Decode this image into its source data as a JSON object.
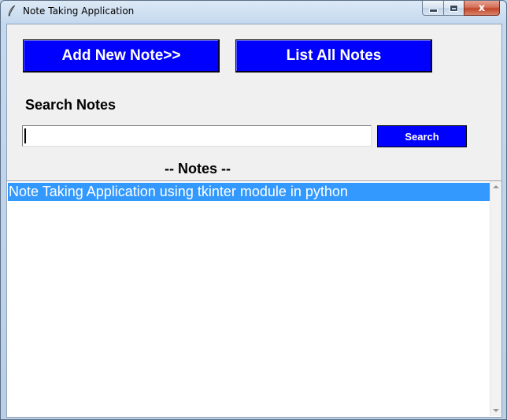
{
  "window": {
    "title": "Note Taking Application",
    "icon": "feather-icon",
    "close_glyph": "x"
  },
  "toolbar": {
    "add_label": "Add New Note>>",
    "list_label": "List All Notes"
  },
  "search": {
    "label": "Search Notes",
    "value": "",
    "button_label": "Search"
  },
  "notes": {
    "heading": "-- Notes --",
    "items": [
      {
        "text": "Note Taking Application using tkinter module in python",
        "selected": true
      }
    ]
  },
  "colors": {
    "button_bg": "#0000ff",
    "button_text": "#ffffff",
    "selection_bg": "#3399ff",
    "client_bg": "#f0f0f0"
  }
}
